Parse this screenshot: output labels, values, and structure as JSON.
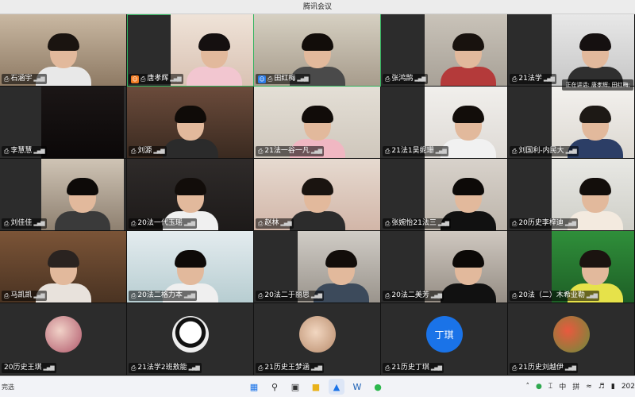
{
  "window": {
    "title": "腾讯会议"
  },
  "speaking_indicator": "正在讲话: 唐孝辉; 田红梅;",
  "participants": [
    {
      "name": "石涵宇",
      "mic": true
    },
    {
      "name": "唐孝辉",
      "mic": true,
      "role": "host"
    },
    {
      "name": "田红梅",
      "mic": true,
      "role": "cohost"
    },
    {
      "name": "张鸿鹄",
      "mic": true
    },
    {
      "name": "21法学",
      "mic": true
    },
    {
      "name": "李慧慧",
      "mic": true
    },
    {
      "name": "刘源",
      "mic": true
    },
    {
      "name": "21法一谷一凡",
      "mic": true
    },
    {
      "name": "21法1吴妮珊",
      "mic": true
    },
    {
      "name": "刘国利-内民大",
      "mic": true
    },
    {
      "name": "刘佳佳",
      "mic": true
    },
    {
      "name": "20法一代玉瑶",
      "mic": true
    },
    {
      "name": "赵林",
      "mic": true
    },
    {
      "name": "张婉怡21法三",
      "mic": true
    },
    {
      "name": "20历史李梓迪",
      "mic": true
    },
    {
      "name": "马凯凯",
      "mic": true
    },
    {
      "name": "20法二格力本",
      "mic": true
    },
    {
      "name": "20法二于丽思",
      "mic": true
    },
    {
      "name": "20法二美芳",
      "mic": true
    },
    {
      "name": "20法（二）木希业勒",
      "mic": true
    },
    {
      "name": "20历史王琪",
      "mic": false
    },
    {
      "name": "21法学2班敖能",
      "mic": true
    },
    {
      "name": "21历史王梦涵",
      "mic": true
    },
    {
      "name": "21历史丁琪",
      "mic": true,
      "avatar_text": "丁琪"
    },
    {
      "name": "21历史刘越伊",
      "mic": true
    }
  ],
  "taskbar": {
    "left_text": "完选",
    "ime": "中",
    "ime2": "拼",
    "clock": "202"
  }
}
